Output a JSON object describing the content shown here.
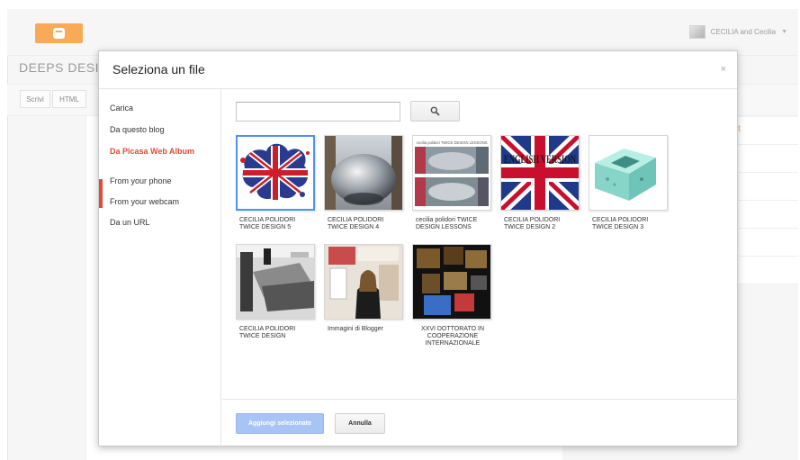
{
  "app": {
    "blog_title": "DEEPS DESIG",
    "user_name": "CECILIA and Cecilia",
    "tabs": [
      {
        "label": "Scrivi"
      },
      {
        "label": "HTML"
      }
    ],
    "side_hint": "t"
  },
  "dialog": {
    "title": "Seleziona un file",
    "close": "×",
    "nav": [
      {
        "label": "Carica"
      },
      {
        "label": "Da questo blog"
      },
      {
        "label": "Da Picasa Web Album"
      },
      {
        "label": "From your phone"
      },
      {
        "label": "From your webcam"
      },
      {
        "label": "Da un URL"
      }
    ],
    "active_nav_index": 2,
    "search": {
      "value": "",
      "placeholder": "",
      "icon": "search-icon"
    },
    "albums": [
      {
        "caption": "CECILIA POLIDORI TWICE DESIGN 5",
        "selected": true
      },
      {
        "caption": "CECILIA POLIDORI TWICE DESIGN 4",
        "selected": false
      },
      {
        "caption": "cecilia polidori TWICE DESIGN LESSONS",
        "selected": false
      },
      {
        "caption": "CECILIA POLIDORI TWICE DESIGN 2",
        "selected": false
      },
      {
        "caption": "CECILIA POLIDORI TWICE DESIGN 3",
        "selected": false
      },
      {
        "caption": "CECILIA POLIDORI TWICE DESIGN",
        "selected": false
      },
      {
        "caption": "Immagini di Blogger",
        "selected": false
      },
      {
        "caption": "XXVI DOTTORATO IN COOPERAZIONE INTERNAZIONALE",
        "selected": false
      }
    ],
    "thumb_texts": {
      "lessons": "cecilia polidori TWICE DESIGN LESSONS",
      "english_version": "ENGLISH VERSION"
    },
    "buttons": {
      "add": "Aggiungi selezionate",
      "cancel": "Annulla"
    },
    "colors": {
      "accent": "#dd4b39",
      "primary_button": "#a8c4f4",
      "selection": "#4d90fe",
      "brand": "#f57d00"
    }
  }
}
